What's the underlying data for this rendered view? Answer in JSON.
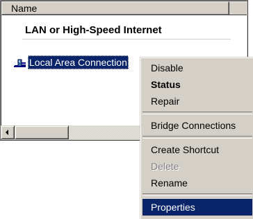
{
  "details_view": {
    "column_header": "Name",
    "group_title": "LAN or High-Speed Internet",
    "selected_item": {
      "label": "Local Area Connection",
      "icon": "network-connection-icon"
    }
  },
  "scrollbar": {
    "left_arrow_icon": "arrow-left-icon"
  },
  "context_menu": {
    "items": [
      {
        "label": "Disable"
      },
      {
        "label": "Status",
        "style": "bold"
      },
      {
        "label": "Repair"
      },
      {
        "label": "Bridge Connections"
      },
      {
        "label": "Create Shortcut"
      },
      {
        "label": "Delete",
        "state": "disabled"
      },
      {
        "label": "Rename"
      },
      {
        "label": "Properties",
        "state": "highlighted"
      }
    ]
  },
  "colors": {
    "selection": "#0a246a",
    "face": "#d4d0c8",
    "disabled_text": "#808080"
  }
}
